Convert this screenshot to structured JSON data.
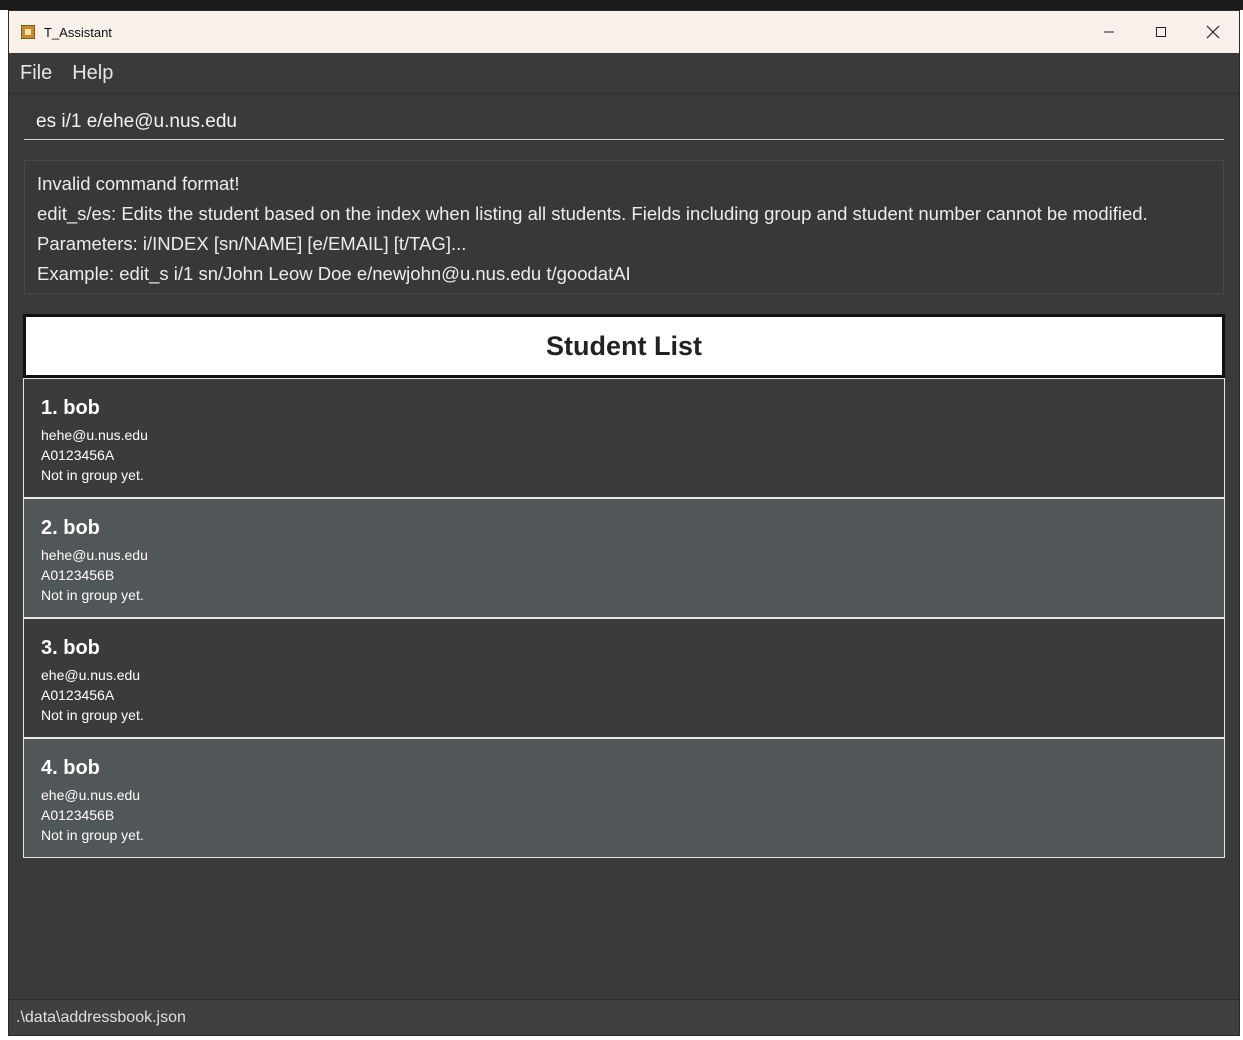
{
  "window": {
    "title": "T_Assistant"
  },
  "menu": {
    "items": [
      "File",
      "Help"
    ]
  },
  "command": {
    "value": "es i/1 e/ehe@u.nus.edu"
  },
  "result": {
    "lines": [
      "Invalid command format!",
      "edit_s/es: Edits the student based on the index when listing all students. Fields including group and student number cannot be modified.",
      "Parameters: i/INDEX [sn/NAME] [e/EMAIL] [t/TAG]...",
      "Example: edit_s i/1 sn/John Leow Doe e/newjohn@u.nus.edu t/goodatAI"
    ]
  },
  "student_list": {
    "title": "Student List",
    "students": [
      {
        "name": "1. bob",
        "email": "hehe@u.nus.edu",
        "id": "A0123456A",
        "group": "Not in group yet."
      },
      {
        "name": "2. bob",
        "email": "hehe@u.nus.edu",
        "id": "A0123456B",
        "group": "Not in group yet."
      },
      {
        "name": "3. bob",
        "email": "ehe@u.nus.edu",
        "id": "A0123456A",
        "group": "Not in group yet."
      },
      {
        "name": "4. bob",
        "email": "ehe@u.nus.edu",
        "id": "A0123456B",
        "group": "Not in group yet."
      }
    ]
  },
  "status": {
    "path": ".\\data\\addressbook.json"
  },
  "icons": {
    "app": "app-icon",
    "minimize": "minimize-icon",
    "maximize": "maximize-icon",
    "close": "close-icon"
  },
  "colors": {
    "background": "#3a3a3a",
    "card_odd": "#3b3b3b",
    "card_even": "#515658",
    "titlebar": "#f7f1ea"
  }
}
